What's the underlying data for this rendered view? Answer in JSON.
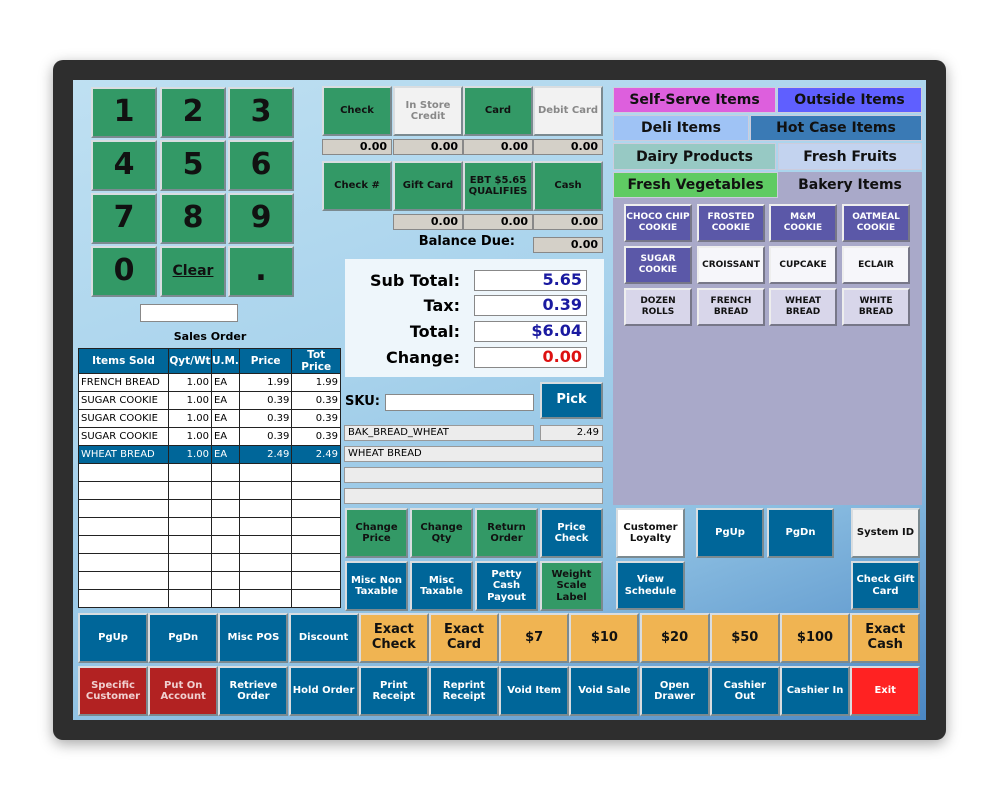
{
  "keypad": [
    "1",
    "2",
    "3",
    "4",
    "5",
    "6",
    "7",
    "8",
    "9",
    "0",
    "Clear",
    "."
  ],
  "sales_order": {
    "title": "Sales Order",
    "columns": [
      "Items Sold",
      "Qyt/Wt",
      "U.M.",
      "Price",
      "Tot Price"
    ],
    "rows": [
      {
        "item": "FRENCH BREAD",
        "qty": "1.00",
        "um": "EA",
        "price": "1.99",
        "total": "1.99"
      },
      {
        "item": "SUGAR COOKIE",
        "qty": "1.00",
        "um": "EA",
        "price": "0.39",
        "total": "0.39"
      },
      {
        "item": "SUGAR COOKIE",
        "qty": "1.00",
        "um": "EA",
        "price": "0.39",
        "total": "0.39"
      },
      {
        "item": "SUGAR COOKIE",
        "qty": "1.00",
        "um": "EA",
        "price": "0.39",
        "total": "0.39"
      },
      {
        "item": "WHEAT BREAD",
        "qty": "1.00",
        "um": "EA",
        "price": "2.49",
        "total": "2.49"
      }
    ],
    "selected_row": 4
  },
  "payments": {
    "row1": [
      {
        "label": "Check",
        "amount": "0.00"
      },
      {
        "label": "In Store Credit",
        "amount": "0.00"
      },
      {
        "label": "Card",
        "amount": "0.00"
      },
      {
        "label": "Debit Card",
        "amount": "0.00"
      }
    ],
    "row2": [
      {
        "label": "Check #"
      },
      {
        "label": "Gift Card",
        "amount": "0.00"
      },
      {
        "label": "EBT $5.65 QUALIFIES",
        "amount": "0.00"
      },
      {
        "label": "Cash",
        "amount": "0.00"
      }
    ],
    "balance_due_label": "Balance Due:",
    "balance_due": "0.00"
  },
  "totals": {
    "subtotal_label": "Sub Total:",
    "subtotal": "5.65",
    "tax_label": "Tax:",
    "tax": "0.39",
    "total_label": "Total:",
    "total": "$6.04",
    "change_label": "Change:",
    "change": "0.00"
  },
  "sku": {
    "label": "SKU:",
    "value": "",
    "pick": "Pick",
    "code": "BAK_BREAD_WHEAT",
    "price": "2.49",
    "name": "WHEAT BREAD"
  },
  "actions": [
    "Change Price",
    "Change Qty",
    "Return Order",
    "Price Check",
    "Misc Non Taxable",
    "Misc Taxable",
    "Petty Cash Payout",
    "Weight Scale Label"
  ],
  "side": {
    "customer_loyalty": "Customer Loyalty",
    "view_schedule": "View Schedule",
    "pgup": "PgUp",
    "pgdn": "PgDn",
    "system_id": "System ID",
    "check_gift_card": "Check Gift Card"
  },
  "categories": [
    {
      "label": "Self-Serve Items",
      "color": "#dd5fdd"
    },
    {
      "label": "Outside Items",
      "color": "#5f5fff"
    },
    {
      "label": "Deli Items",
      "color": "#9fc3f5"
    },
    {
      "label": "Hot Case Items",
      "color": "#3a7ab5"
    },
    {
      "label": "Dairy Products",
      "color": "#97c9c4"
    },
    {
      "label": "Fresh Fruits",
      "color": "#c3d3ef"
    },
    {
      "label": "Fresh Vegetables",
      "color": "#5fcb63"
    },
    {
      "label": "Bakery Items",
      "color": "#a9a9c9"
    }
  ],
  "active_category": "Bakery Items",
  "items": [
    "CHOCO CHIP COOKIE",
    "FROSTED COOKIE",
    "M&M COOKIE",
    "OATMEAL COOKIE",
    "SUGAR COOKIE",
    "CROISSANT",
    "CUPCAKE",
    "ECLAIR",
    "DOZEN ROLLS",
    "FRENCH BREAD",
    "WHEAT BREAD",
    "WHITE BREAD"
  ],
  "bottom_row1": [
    "PgUp",
    "PgDn",
    "Misc POS",
    "Discount",
    "Exact Check",
    "Exact Card",
    "$7",
    "$10",
    "$20",
    "$50",
    "$100",
    "Exact Cash"
  ],
  "bottom_row2": [
    "Specific Customer",
    "Put On Account",
    "Retrieve Order",
    "Hold Order",
    "Print Receipt",
    "Reprint Receipt",
    "Void Item",
    "Void Sale",
    "Open Drawer",
    "Cashier Out",
    "Cashier In",
    "Exit"
  ]
}
